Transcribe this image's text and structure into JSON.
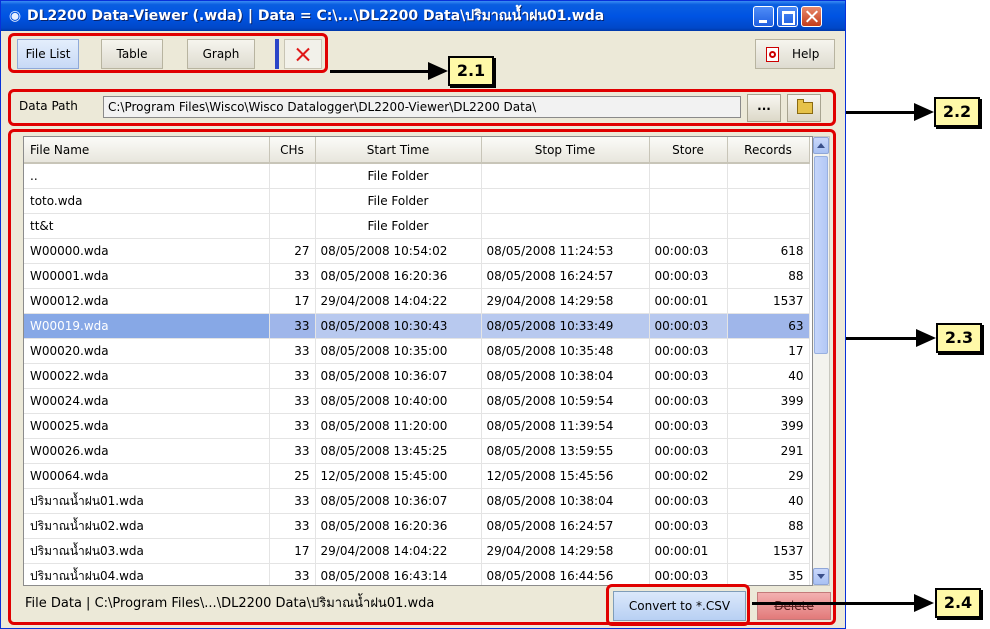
{
  "window": {
    "title": "DL2200 Data-Viewer (.wda) | Data = C:\\...\\DL2200 Data\\ปริมาณน้ำฝน01.wda",
    "app_icon": "eye-icon"
  },
  "toolbar": {
    "file_list_label": "File List",
    "table_label": "Table",
    "graph_label": "Graph",
    "help_label": "Help"
  },
  "path": {
    "label": "Data Path",
    "value": "C:\\Program Files\\Wisco\\Wisco Datalogger\\DL2200-Viewer\\DL2200 Data\\",
    "browse_label": "..."
  },
  "grid": {
    "columns": [
      "File Name",
      "CHs",
      "Start Time",
      "Stop Time",
      "Store",
      "Records"
    ],
    "rows": [
      {
        "name": "..",
        "chs": "",
        "start": "File Folder",
        "stop": "",
        "store": "",
        "records": ""
      },
      {
        "name": "toto.wda",
        "chs": "",
        "start": "File Folder",
        "stop": "",
        "store": "",
        "records": ""
      },
      {
        "name": "tt&t",
        "chs": "",
        "start": "File Folder",
        "stop": "",
        "store": "",
        "records": ""
      },
      {
        "name": "W00000.wda",
        "chs": "27",
        "start": "08/05/2008  10:54:02",
        "stop": "08/05/2008  11:24:53",
        "store": "00:00:03",
        "records": "618"
      },
      {
        "name": "W00001.wda",
        "chs": "33",
        "start": "08/05/2008  16:20:36",
        "stop": "08/05/2008  16:24:57",
        "store": "00:00:03",
        "records": "88"
      },
      {
        "name": "W00012.wda",
        "chs": "17",
        "start": "29/04/2008  14:04:22",
        "stop": "29/04/2008  14:29:58",
        "store": "00:00:01",
        "records": "1537"
      },
      {
        "name": "W00019.wda",
        "chs": "33",
        "start": "08/05/2008  10:30:43",
        "stop": "08/05/2008  10:33:49",
        "store": "00:00:03",
        "records": "63"
      },
      {
        "name": "W00020.wda",
        "chs": "33",
        "start": "08/05/2008  10:35:00",
        "stop": "08/05/2008  10:35:48",
        "store": "00:00:03",
        "records": "17"
      },
      {
        "name": "W00022.wda",
        "chs": "33",
        "start": "08/05/2008  10:36:07",
        "stop": "08/05/2008  10:38:04",
        "store": "00:00:03",
        "records": "40"
      },
      {
        "name": "W00024.wda",
        "chs": "33",
        "start": "08/05/2008  10:40:00",
        "stop": "08/05/2008  10:59:54",
        "store": "00:00:03",
        "records": "399"
      },
      {
        "name": "W00025.wda",
        "chs": "33",
        "start": "08/05/2008  11:20:00",
        "stop": "08/05/2008  11:39:54",
        "store": "00:00:03",
        "records": "399"
      },
      {
        "name": "W00026.wda",
        "chs": "33",
        "start": "08/05/2008  13:45:25",
        "stop": "08/05/2008  13:59:55",
        "store": "00:00:03",
        "records": "291"
      },
      {
        "name": "W00064.wda",
        "chs": "25",
        "start": "12/05/2008  15:45:00",
        "stop": "12/05/2008  15:45:56",
        "store": "00:00:02",
        "records": "29"
      },
      {
        "name": "ปริมาณน้ำฝน01.wda",
        "chs": "33",
        "start": "08/05/2008  10:36:07",
        "stop": "08/05/2008  10:38:04",
        "store": "00:00:03",
        "records": "40"
      },
      {
        "name": "ปริมาณน้ำฝน02.wda",
        "chs": "33",
        "start": "08/05/2008  16:20:36",
        "stop": "08/05/2008  16:24:57",
        "store": "00:00:03",
        "records": "88"
      },
      {
        "name": "ปริมาณน้ำฝน03.wda",
        "chs": "17",
        "start": "29/04/2008  14:04:22",
        "stop": "29/04/2008  14:29:58",
        "store": "00:00:01",
        "records": "1537"
      },
      {
        "name": "ปริมาณน้ำฝน04.wda",
        "chs": "33",
        "start": "08/05/2008  16:43:14",
        "stop": "08/05/2008  16:44:56",
        "store": "00:00:03",
        "records": "35"
      }
    ],
    "selected_index": 6
  },
  "status": {
    "text": "File Data | C:\\Program Files\\...\\DL2200 Data\\ปริมาณน้ำฝน01.wda",
    "convert_label": "Convert to *.CSV",
    "delete_label": "Delete"
  },
  "callouts": {
    "c21": "2.1",
    "c22": "2.2",
    "c23": "2.3",
    "c24": "2.4"
  },
  "colors": {
    "annotation_red": "#e00000",
    "callout_yellow": "#fff9a8",
    "title_bar_blue": "#0054e3",
    "selection_blue": "#87a8e6"
  }
}
